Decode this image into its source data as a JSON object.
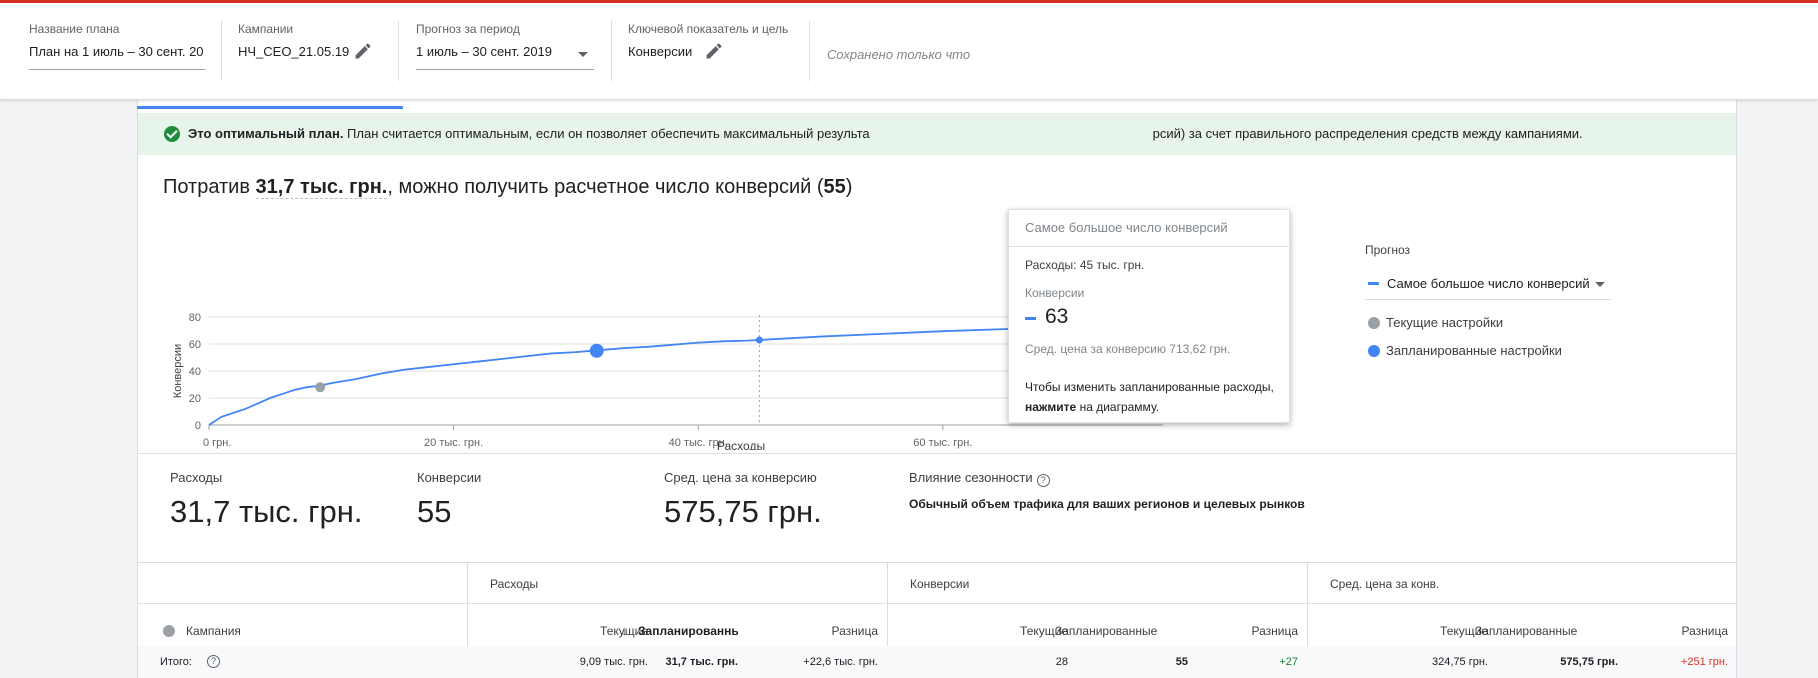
{
  "header": {
    "plan_name_label": "Название плана",
    "plan_name_value": "План на 1 июль – 30 сент. 20",
    "campaigns_label": "Кампании",
    "campaigns_value": "НЧ_СЕО_21.05.19",
    "period_label": "Прогноз за период",
    "period_value": "1 июль – 30 сент. 2019",
    "kpi_label": "Ключевой показатель и цель",
    "kpi_value": "Конверсии",
    "saved_status": "Сохранено только что"
  },
  "banner": {
    "bold": "Это оптимальный план.",
    "text": " План считается оптимальным, если он позволяет обеспечить максимальный результа",
    "text_tail": "рсий) за счет правильного распределения средств между кампаниями."
  },
  "headline": {
    "prefix": "Потратив ",
    "spend": "31,7 тыс. грн.",
    "middle": ", можно получить расчетное число конверсий (",
    "conv": "55",
    "suffix": ")"
  },
  "chart_data": {
    "type": "line",
    "xlabel": "Расходы",
    "ylabel": "Конверсии",
    "xlim": [
      0,
      78
    ],
    "ylim": [
      0,
      80
    ],
    "x_ticks": [
      {
        "value": 0,
        "label": "0 грн."
      },
      {
        "value": 20,
        "label": "20 тыс. грн."
      },
      {
        "value": 40,
        "label": "40 тыс. грн."
      },
      {
        "value": 60,
        "label": "60 тыс. грн."
      }
    ],
    "y_ticks": [
      0,
      20,
      40,
      60,
      80
    ],
    "series": [
      {
        "name": "Самое большое число конверсий",
        "color": "#4285f4",
        "x": [
          0,
          1,
          2,
          3,
          4,
          5,
          6,
          7,
          8,
          9,
          10,
          12,
          14,
          16,
          18,
          20,
          22,
          24,
          26,
          28,
          30,
          32,
          34,
          36,
          38,
          40,
          42,
          44,
          45,
          50,
          55,
          60,
          65,
          70,
          75,
          78
        ],
        "y": [
          0,
          6,
          9,
          12,
          16,
          20,
          23,
          26,
          28,
          29,
          31,
          34,
          38,
          41,
          43,
          45,
          47,
          49,
          51,
          53,
          54,
          55.5,
          57,
          58,
          59.5,
          61,
          62,
          62.5,
          63,
          65.5,
          67.5,
          69.5,
          71,
          72.5,
          74,
          75
        ]
      }
    ],
    "points": [
      {
        "name": "Текущие настройки",
        "x": 9.09,
        "y": 28,
        "color": "#9aa0a6"
      },
      {
        "name": "Запланированные настройки",
        "x": 31.7,
        "y": 55,
        "color": "#4285f4"
      }
    ],
    "hover_x": 45,
    "hover_y": 63,
    "legend_position": "right",
    "grid": true
  },
  "legend": {
    "title": "Прогноз",
    "selected": "Самое большое число конверсий",
    "current": "Текущие настройки",
    "planned": "Запланированные настройки"
  },
  "tooltip": {
    "title": "Самое большое число конверсий",
    "spend": "Расходы: 45 тыс. грн.",
    "conv_label": "Конверсии",
    "conv_value": "63",
    "cpa": "Сред. цена за конверсию 713,62 грн.",
    "hint_prefix": "Чтобы изменить запланированные расходы, ",
    "hint_bold": "нажмите",
    "hint_suffix": " на диаграмму."
  },
  "stats": {
    "spend_label": "Расходы",
    "spend_value": "31,7 тыс. грн.",
    "conv_label": "Конверсии",
    "conv_value": "55",
    "cpa_label": "Сред. цена за конверсию",
    "cpa_value": "575,75 грн.",
    "season_label": "Влияние сезонности",
    "season_q": "?",
    "season_desc": "Обычный объем трафика для ваших регионов и целевых рынков"
  },
  "table": {
    "group_spend": "Расходы",
    "group_conv": "Конверсии",
    "group_cpa": "Сред. цена за конв.",
    "col_campaign": "Кампания",
    "col_current": "Текущие",
    "col_planned": "Запланированные",
    "col_diff": "Разница",
    "sort_arrow": "↓",
    "total_label": "Итого:",
    "total_q": "?",
    "total": {
      "spend_current": "9,09 тыс. грн.",
      "spend_planned": "31,7 тыс. грн.",
      "spend_diff": "+22,6 тыс. грн.",
      "conv_current": "28",
      "conv_planned": "55",
      "conv_diff": "+27",
      "cpa_current": "324,75 грн.",
      "cpa_planned": "575,75 грн.",
      "cpa_diff": "+251 грн."
    },
    "colors": {
      "positive": "#188038",
      "negative": "#d93025"
    }
  }
}
